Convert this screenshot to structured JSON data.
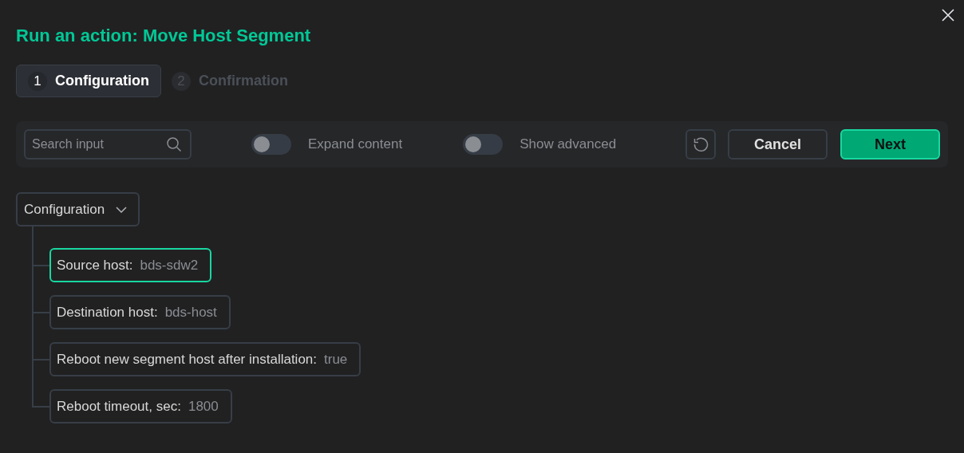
{
  "dialog": {
    "title": "Run an action: Move Host Segment"
  },
  "steps": [
    {
      "number": "1",
      "label": "Configuration",
      "selected": true
    },
    {
      "number": "2",
      "label": "Confirmation",
      "selected": false
    }
  ],
  "toolbar": {
    "search": {
      "placeholder": "Search input"
    },
    "toggles": [
      {
        "label": "Expand content",
        "on": false
      },
      {
        "label": "Show advanced",
        "on": false
      }
    ],
    "buttons": [
      {
        "kind": "reset"
      },
      {
        "kind": "secondary",
        "label": "Cancel"
      },
      {
        "kind": "primary",
        "label": "Next"
      }
    ]
  },
  "tree": {
    "label": "Configuration",
    "expanded": true,
    "children": [
      {
        "label": "Source host:",
        "value": "bds-sdw2",
        "selected": true
      },
      {
        "label": "Destination host:",
        "value": "bds-host",
        "selected": false
      },
      {
        "label": "Reboot new segment host after installation:",
        "value": "true",
        "selected": false
      },
      {
        "label": "Reboot timeout, sec:",
        "value": "1800",
        "selected": false
      }
    ]
  }
}
